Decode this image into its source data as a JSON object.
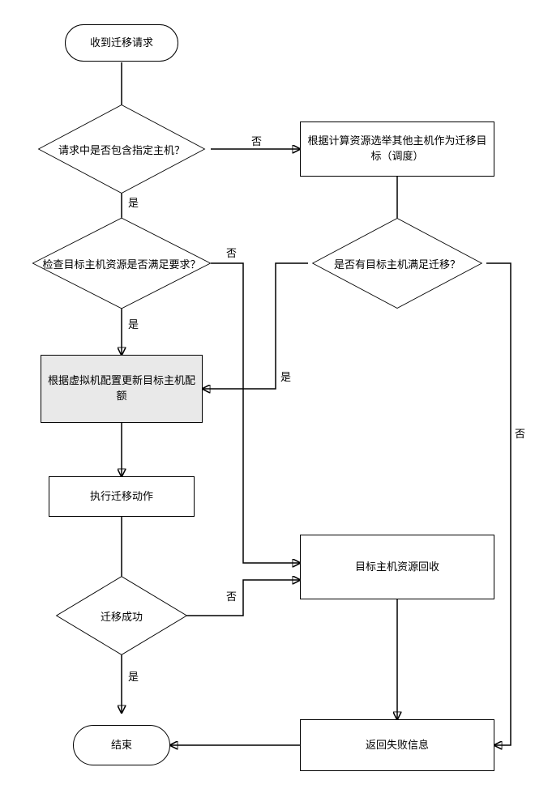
{
  "chart_data": {
    "type": "flowchart",
    "nodes": [
      {
        "id": "start",
        "shape": "terminator",
        "text": "收到迁移请求"
      },
      {
        "id": "d_has_host",
        "shape": "decision",
        "text": "请求中是否包含指定主机？"
      },
      {
        "id": "p_schedule",
        "shape": "process",
        "text": "根据计算资源选举其他主机作为迁移目标（调度）"
      },
      {
        "id": "d_check_res",
        "shape": "decision",
        "text": "检查目标主机资源是否满足要求？"
      },
      {
        "id": "d_has_target",
        "shape": "decision",
        "text": "是否有目标主机满足迁移？"
      },
      {
        "id": "p_update",
        "shape": "process",
        "text": "根据虚拟机配置更新目标主机配额"
      },
      {
        "id": "p_exec",
        "shape": "process",
        "text": "执行迁移动作"
      },
      {
        "id": "p_reclaim",
        "shape": "process",
        "text": "目标主机资源回收"
      },
      {
        "id": "d_success",
        "shape": "decision",
        "text": "迁移成功"
      },
      {
        "id": "p_fail",
        "shape": "process",
        "text": "返回失败信息"
      },
      {
        "id": "end",
        "shape": "terminator",
        "text": "结束"
      }
    ],
    "edges": [
      {
        "from": "start",
        "to": "d_has_host",
        "label": ""
      },
      {
        "from": "d_has_host",
        "to": "d_check_res",
        "label": "是"
      },
      {
        "from": "d_has_host",
        "to": "p_schedule",
        "label": "否"
      },
      {
        "from": "p_schedule",
        "to": "d_has_target",
        "label": ""
      },
      {
        "from": "d_check_res",
        "to": "p_update",
        "label": "是"
      },
      {
        "from": "d_check_res",
        "to": "p_reclaim",
        "label": "否"
      },
      {
        "from": "d_has_target",
        "to": "p_update",
        "label": "是"
      },
      {
        "from": "d_has_target",
        "to": "p_fail",
        "label": "否"
      },
      {
        "from": "p_update",
        "to": "p_exec",
        "label": ""
      },
      {
        "from": "p_exec",
        "to": "d_success",
        "label": ""
      },
      {
        "from": "d_success",
        "to": "end",
        "label": "是"
      },
      {
        "from": "d_success",
        "to": "p_reclaim",
        "label": "否"
      },
      {
        "from": "p_reclaim",
        "to": "p_fail",
        "label": ""
      },
      {
        "from": "p_fail",
        "to": "end",
        "label": ""
      }
    ]
  },
  "nodes": {
    "start": "收到迁移请求",
    "d_has_host": "请求中是否包含指定主机？",
    "p_schedule": "根据计算资源选举其他主机作为迁移目标（调度）",
    "d_check_res": "检查目标主机资源是否满足要求？",
    "d_has_target": "是否有目标主机满足迁移？",
    "p_update": "根据虚拟机配置更新目标主机配额",
    "p_exec": "执行迁移动作",
    "p_reclaim": "目标主机资源回收",
    "d_success": "迁移成功",
    "p_fail": "返回失败信息",
    "end": "结束"
  },
  "labels": {
    "yes": "是",
    "no": "否"
  }
}
